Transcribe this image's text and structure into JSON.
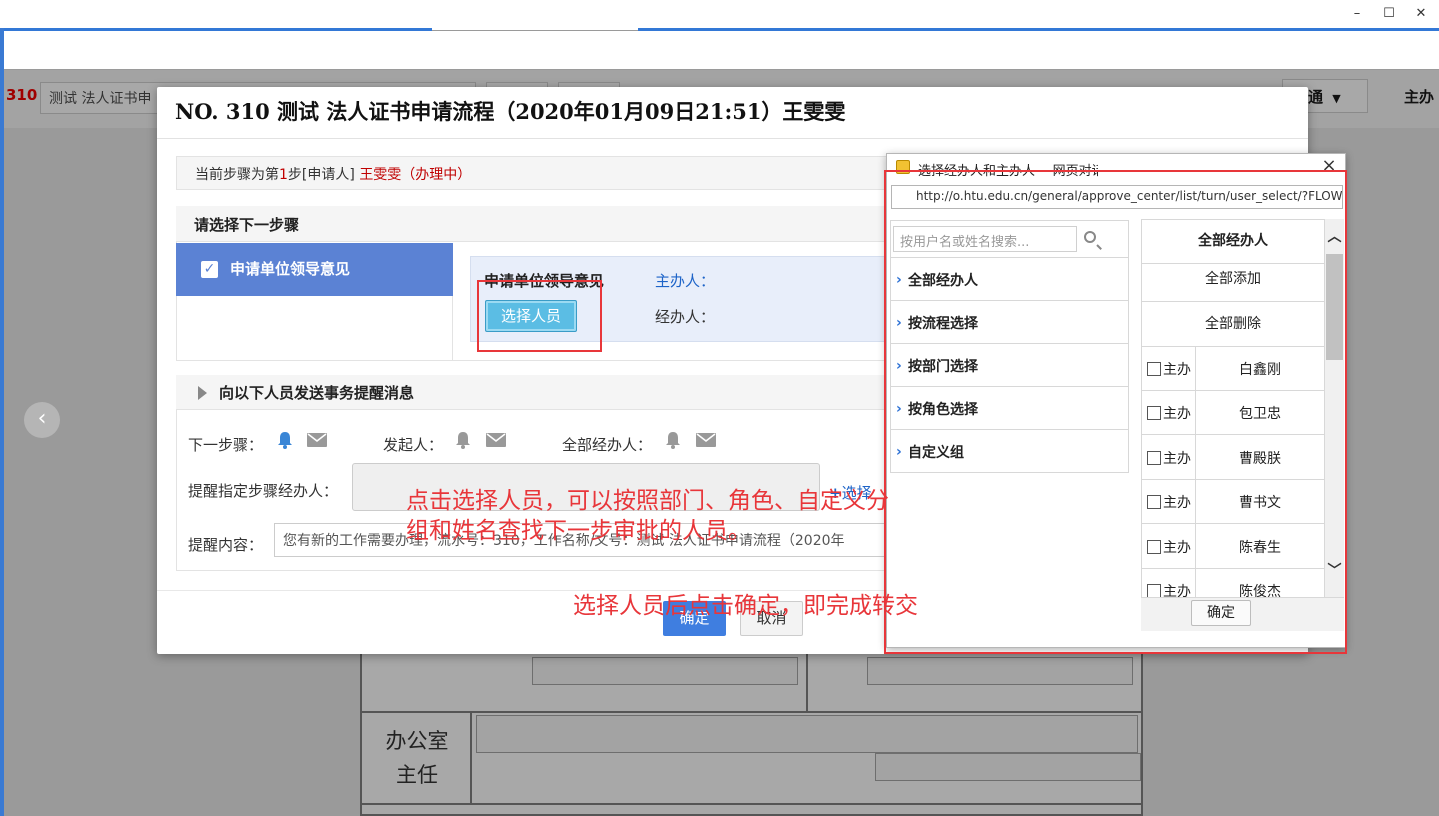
{
  "window": {
    "minimize": "–",
    "maximize": "☐",
    "close": "✕"
  },
  "background": {
    "run_no": "310",
    "run_title": "测试 法人证书申",
    "mode_select": "普通",
    "host_label": "主办",
    "nav_prev": "‹",
    "office_label": "办公室主任"
  },
  "modal": {
    "title": "NO. 310 测试 法人证书申请流程（2020年01月09日21:51）王雯雯",
    "current_step": {
      "prefix": "当前步骤为第",
      "step_no": "1",
      "suffix": "步[申请人]",
      "person": "王雯雯（办理中）"
    },
    "next_step": {
      "header": "请选择下一步骤",
      "option": "申请单位领导意见",
      "detail_name": "申请单位领导意见",
      "host_label": "主办人：",
      "agent_label": "经办人：",
      "select_button": "选择人员"
    },
    "notice": {
      "header": "向以下人员发送事务提醒消息",
      "next_step_label": "下一步骤：",
      "initiator_label": "发起人：",
      "all_agents_label": "全部经办人：",
      "remind_label": "提醒指定步骤经办人：",
      "select_link": "选择",
      "content_label": "提醒内容：",
      "content_value": "您有新的工作需要办理，流水号：310，工作名称/文号：测试 法人证书申请流程（2020年"
    },
    "ok_button": "确定",
    "cancel_button": "取消"
  },
  "annotations": {
    "a1": "点击选择人员，可以按照部门、角色、自定义分组和姓名查找下一步审批的人员。",
    "a2": "选择人员后点击确定，即完成转交"
  },
  "popup": {
    "title": "选择经办人和主办人 -- 网页对话框",
    "url": "http://o.htu.edu.cn/general/approve_center/list/turn/user_select/?FLOW_ID",
    "search_placeholder": "按用户名或姓名搜索...",
    "menu": [
      {
        "label": "全部经办人"
      },
      {
        "label": "按流程选择"
      },
      {
        "label": "按部门选择"
      },
      {
        "label": "按角色选择"
      },
      {
        "label": "自定义组"
      }
    ],
    "right_header": "全部经办人",
    "add_all": "全部添加",
    "remove_all": "全部删除",
    "host_tag": "主办",
    "people": [
      {
        "name": "白鑫刚"
      },
      {
        "name": "包卫忠"
      },
      {
        "name": "曹殿朕"
      },
      {
        "name": "曹书文"
      },
      {
        "name": "陈春生"
      },
      {
        "name": "陈俊杰"
      }
    ],
    "ok": "确定",
    "close": "×"
  }
}
